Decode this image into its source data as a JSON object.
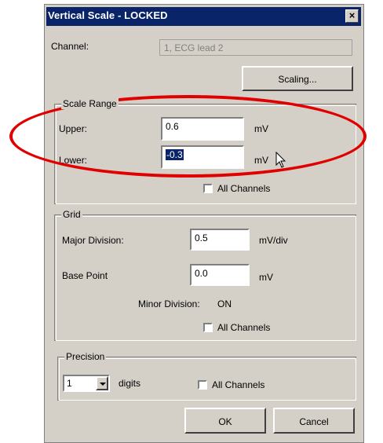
{
  "window": {
    "title": "Vertical Scale - LOCKED",
    "close_label": "×"
  },
  "channel": {
    "label": "Channel:",
    "value": "1, ECG lead 2"
  },
  "scaling_button": "Scaling...",
  "scale_range": {
    "legend": "Scale Range",
    "upper_label": "Upper:",
    "upper_value": "0.6",
    "upper_unit": "mV",
    "lower_label": "Lower:",
    "lower_value": "-0.3",
    "lower_unit": "mV",
    "all_channels": "All Channels"
  },
  "grid": {
    "legend": "Grid",
    "major_label": "Major Division:",
    "major_value": "0.5",
    "major_unit": "mV/div",
    "base_label": "Base Point",
    "base_value": "0.0",
    "base_unit": "mV",
    "minor_label": "Minor Division:",
    "minor_value": "ON",
    "all_channels": "All Channels"
  },
  "precision": {
    "legend": "Precision",
    "digits_value": "1",
    "digits_label": "digits",
    "all_channels": "All Channels"
  },
  "ok_button": "OK",
  "cancel_button": "Cancel",
  "colors": {
    "titlebar": "#0a246a",
    "dialog_bg": "#d4d0c8",
    "annotation": "#e00000"
  }
}
